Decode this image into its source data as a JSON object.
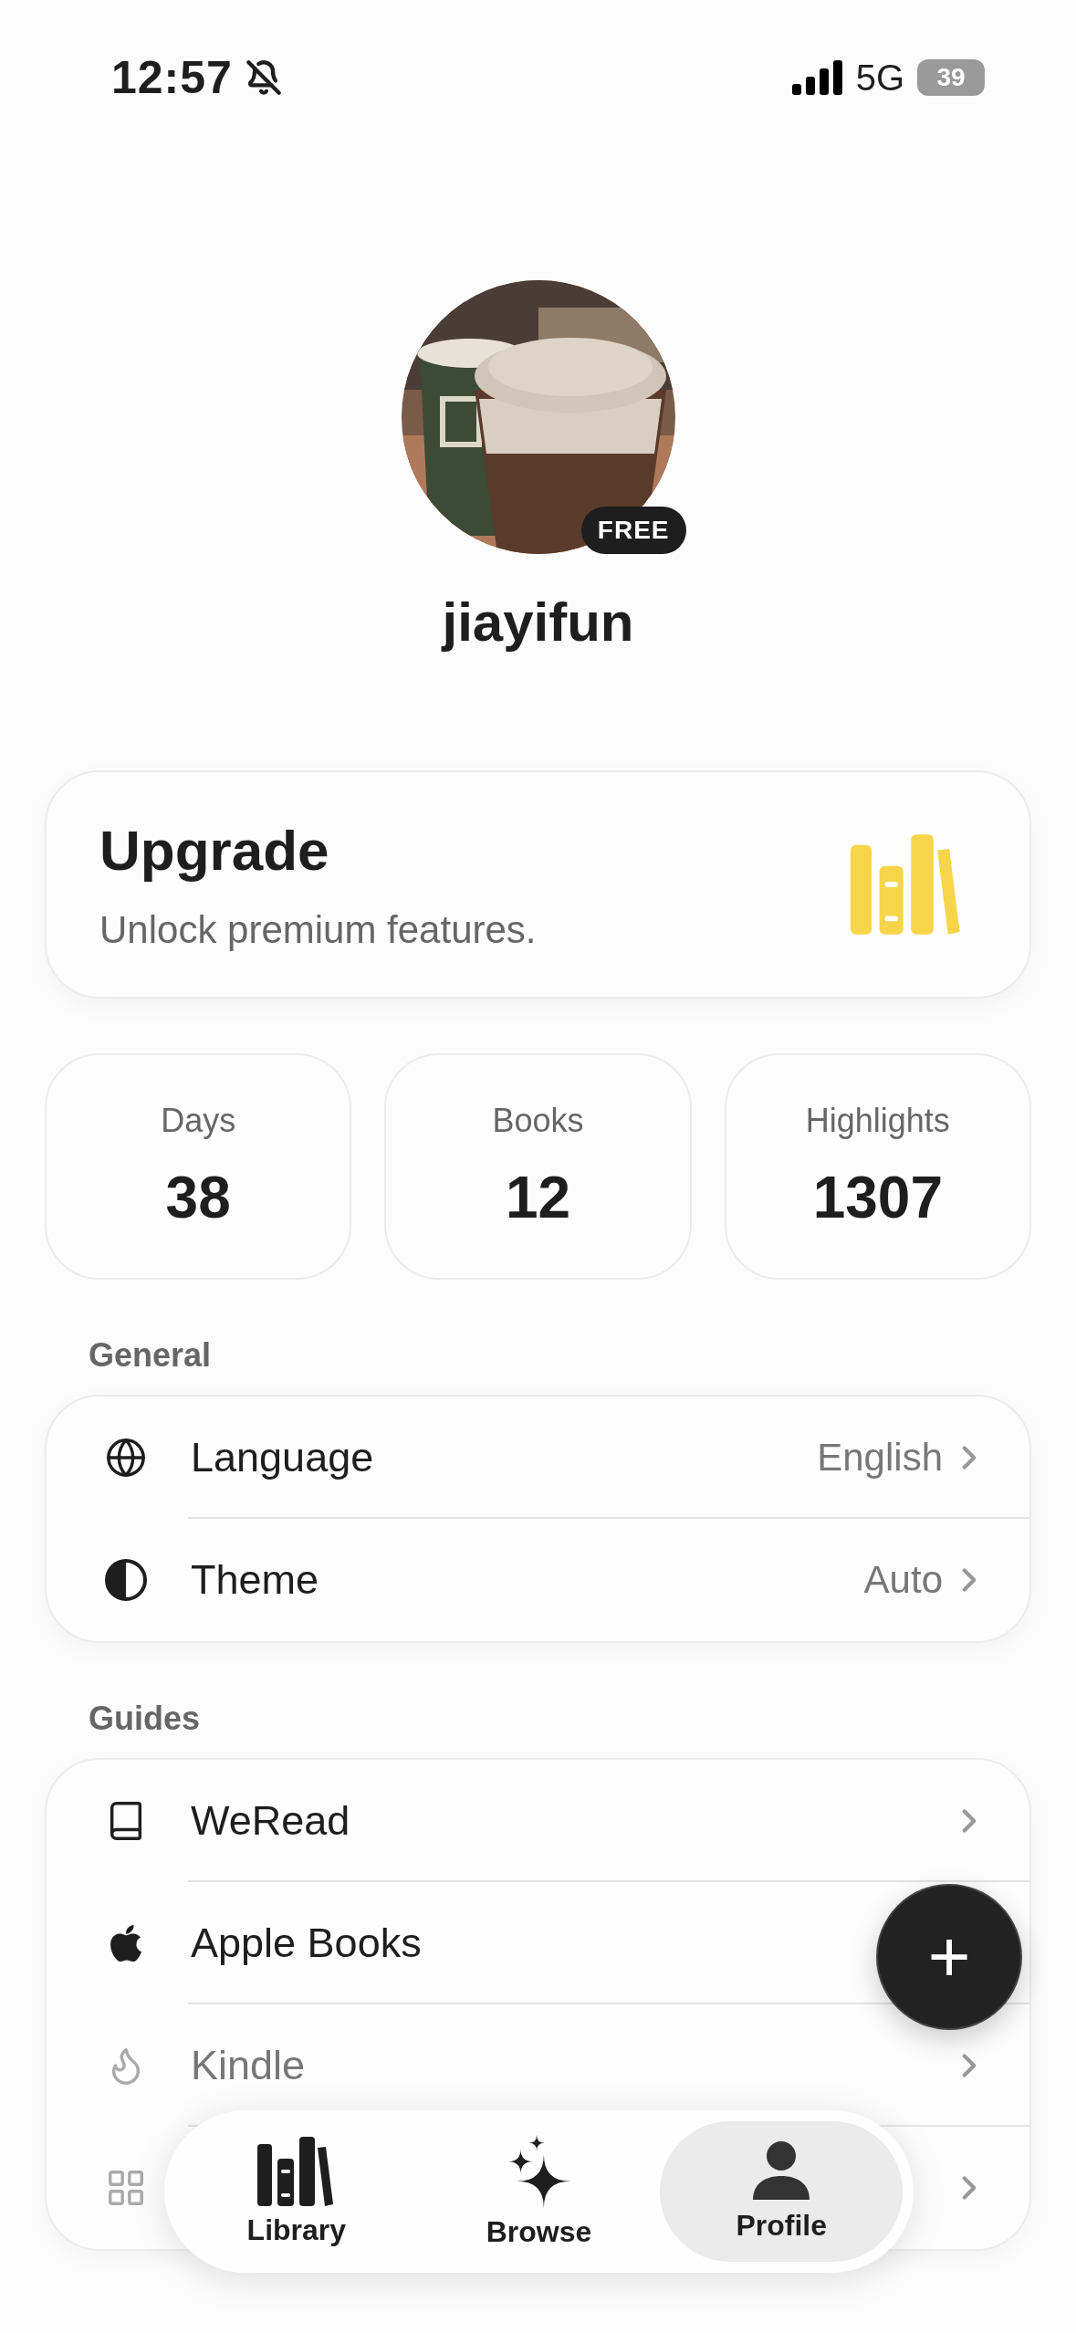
{
  "status_bar": {
    "time": "12:57",
    "network": "5G",
    "battery": "39"
  },
  "profile": {
    "badge": "FREE",
    "username": "jiayifun"
  },
  "upgrade": {
    "title": "Upgrade",
    "subtitle": "Unlock premium features."
  },
  "stats": [
    {
      "label": "Days",
      "value": "38"
    },
    {
      "label": "Books",
      "value": "12"
    },
    {
      "label": "Highlights",
      "value": "1307"
    }
  ],
  "sections": [
    {
      "title": "General",
      "items": [
        {
          "label": "Language",
          "value": "English",
          "chevron": true
        },
        {
          "label": "Theme",
          "value": "Auto",
          "chevron": true
        }
      ]
    },
    {
      "title": "Guides",
      "items": [
        {
          "label": "WeRead",
          "chevron": true
        },
        {
          "label": "Apple Books",
          "chevron": false
        },
        {
          "label": "Kindle",
          "chevron": true
        },
        {
          "chevron": true
        }
      ]
    }
  ],
  "fab": {
    "label": "+"
  },
  "tabs": [
    {
      "label": "Library",
      "selected": false
    },
    {
      "label": "Browse",
      "selected": false
    },
    {
      "label": "Profile",
      "selected": true
    }
  ]
}
